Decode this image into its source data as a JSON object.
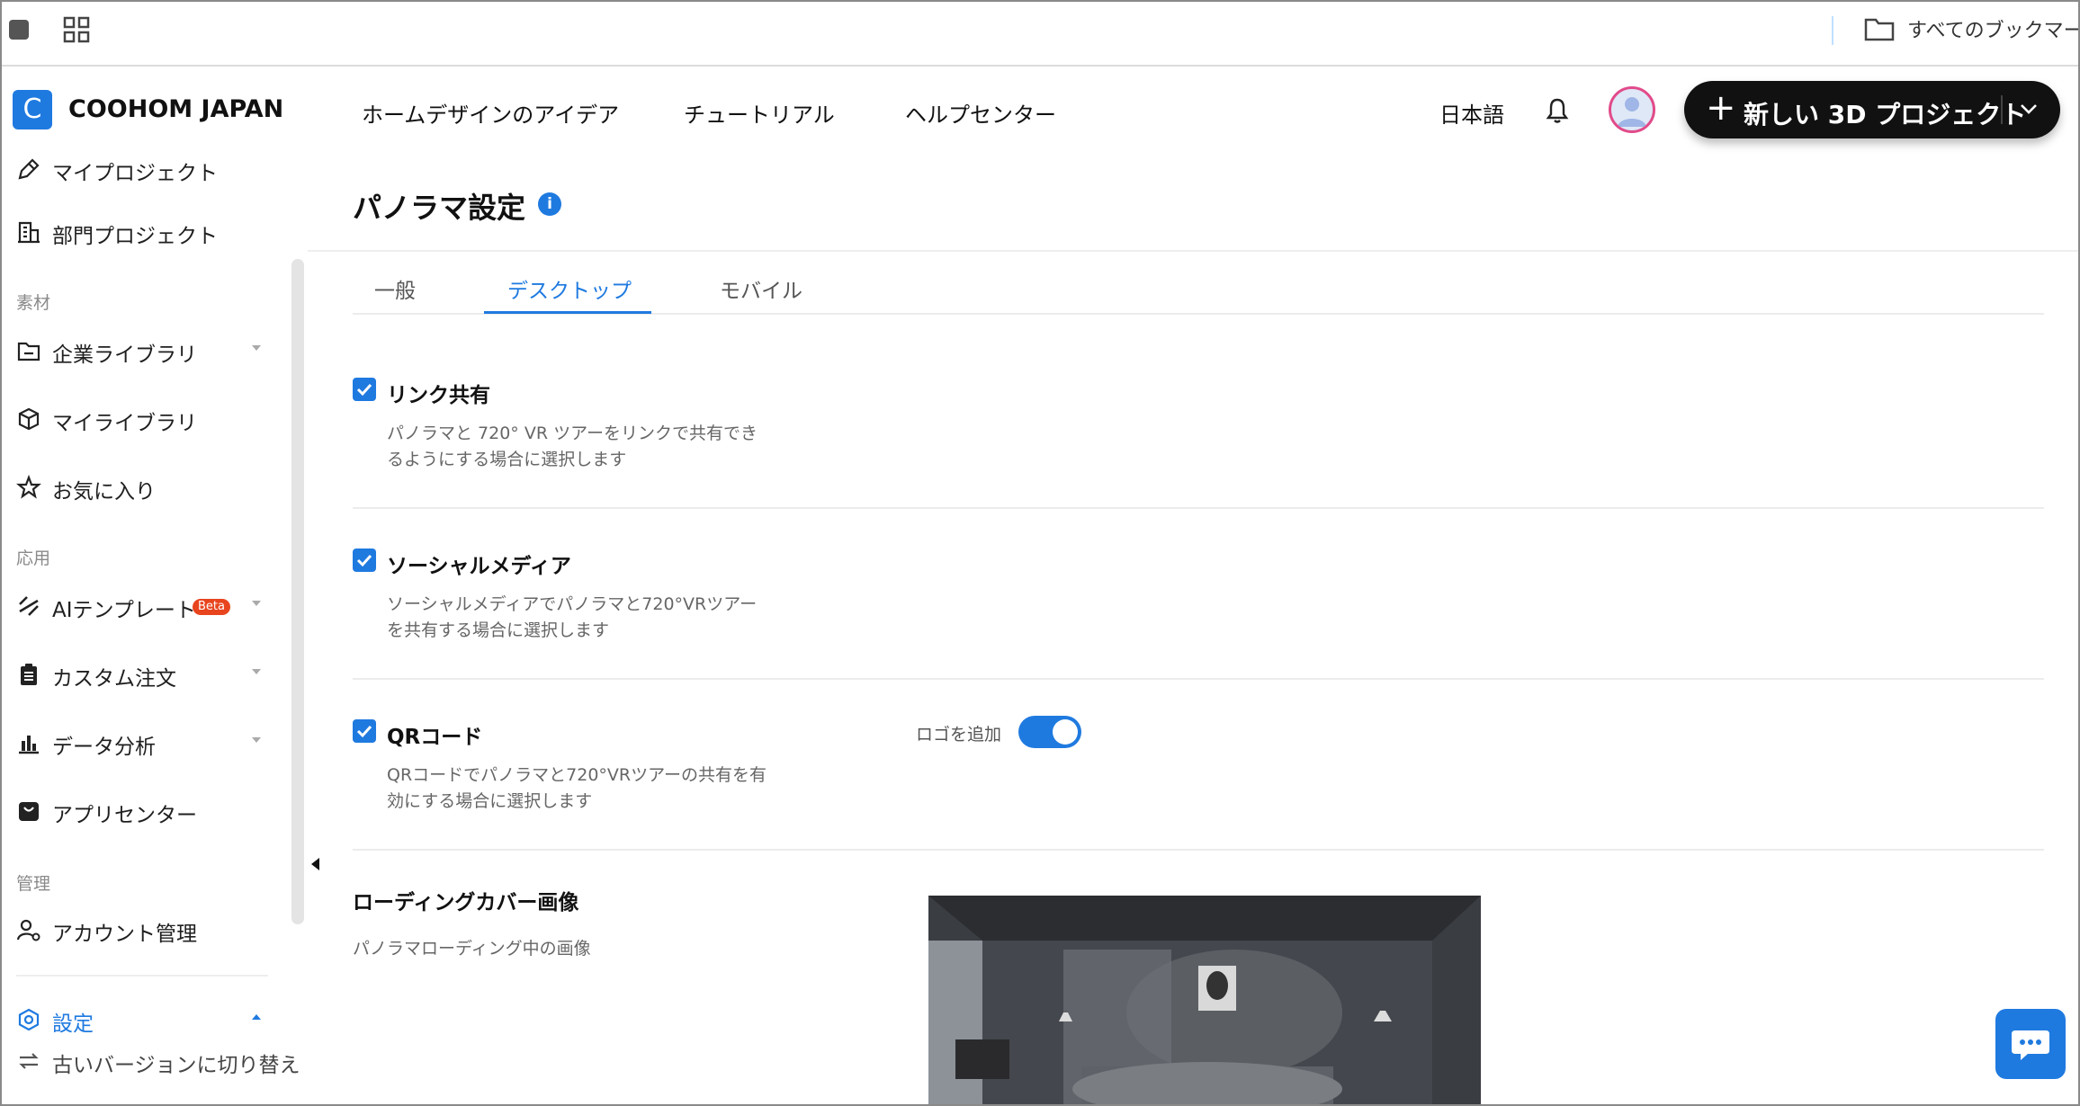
{
  "bookmarks": {
    "all_bookmarks": "すべてのブックマーク"
  },
  "header": {
    "logo_letter": "C",
    "brand": "COOHOM JAPAN",
    "nav": [
      "ホームデザインのアイデア",
      "チュートリアル",
      "ヘルプセンター"
    ],
    "language": "日本語",
    "new_project_plus": "+",
    "new_project_label": "新しい 3D プロジェクト"
  },
  "sidebar": {
    "my_projects": "マイプロジェクト",
    "dept_projects": "部門プロジェクト",
    "section_materials": "素材",
    "corp_library": "企業ライブラリ",
    "my_library": "マイライブラリ",
    "favorites": "お気に入り",
    "section_apps": "応用",
    "ai_templates": "AIテンプレート",
    "beta_badge": "Beta",
    "custom_order": "カスタム注文",
    "data_analysis": "データ分析",
    "app_center": "アプリセンター",
    "section_admin": "管理",
    "account_mgmt": "アカウント管理",
    "settings": "設定",
    "old_version": "古いバージョンに切り替え"
  },
  "main": {
    "title": "パノラマ設定",
    "info_glyph": "i",
    "tabs": [
      "一般",
      "デスクトップ",
      "モバイル"
    ],
    "active_tab": "デスクトップ",
    "settings": [
      {
        "title": "リンク共有",
        "checked": true,
        "desc_lines": [
          "パノラマと 720° VR ツアーをリンクで共有でき",
          "るようにする場合に選択します"
        ]
      },
      {
        "title": "ソーシャルメディア",
        "checked": true,
        "desc_lines": [
          "ソーシャルメディアでパノラマと720°VRツアー",
          "を共有する場合に選択します"
        ]
      },
      {
        "title": "QRコード",
        "checked": true,
        "desc_lines": [
          "QRコードでパノラマと720°VRツアーの共有を有",
          "効にする場合に選択します"
        ]
      }
    ],
    "add_logo_label": "ロゴを追加",
    "add_logo_on": true,
    "cover_title": "ローディングカバー画像",
    "cover_desc": "パノラマローディング中の画像"
  },
  "colors": {
    "accent": "#1f7ae0",
    "beta": "#e8451f",
    "dark_button": "#111111"
  }
}
